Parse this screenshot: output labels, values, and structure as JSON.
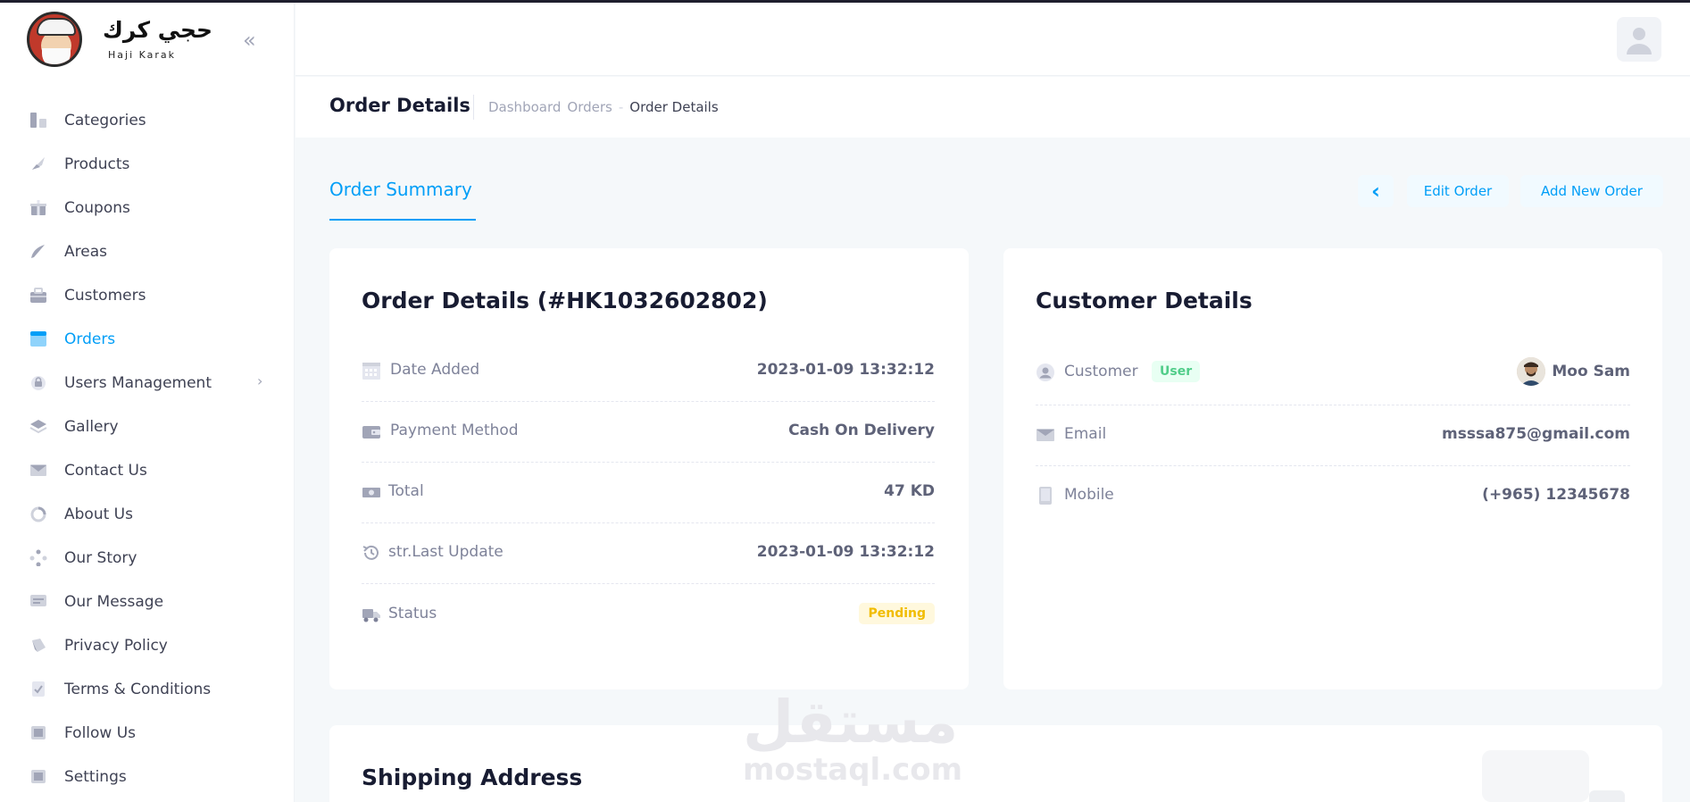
{
  "brand": {
    "name_ar": "حجي كرك",
    "name_en": "Haji Karak"
  },
  "sidebar": {
    "items": [
      {
        "label": "Categories",
        "icon": "categories-icon"
      },
      {
        "label": "Products",
        "icon": "rocket-icon"
      },
      {
        "label": "Coupons",
        "icon": "gift-icon"
      },
      {
        "label": "Areas",
        "icon": "pen-icon"
      },
      {
        "label": "Customers",
        "icon": "briefcase-icon"
      },
      {
        "label": "Orders",
        "icon": "window-icon",
        "active": true
      },
      {
        "label": "Users Management",
        "icon": "lock-icon",
        "has_submenu": true
      },
      {
        "label": "Gallery",
        "icon": "layers-icon"
      },
      {
        "label": "Contact Us",
        "icon": "mail-icon"
      },
      {
        "label": "About Us",
        "icon": "pie-chart-icon"
      },
      {
        "label": "Our Story",
        "icon": "diamond-dots-icon"
      },
      {
        "label": "Our Message",
        "icon": "message-icon"
      },
      {
        "label": "Privacy Policy",
        "icon": "shield-icon"
      },
      {
        "label": "Terms & Conditions",
        "icon": "check-doc-icon"
      },
      {
        "label": "Follow Us",
        "icon": "share-icon"
      },
      {
        "label": "Settings",
        "icon": "settings-icon"
      }
    ],
    "submenu_arrow": "›",
    "collapse_glyph": "«"
  },
  "page": {
    "title": "Order Details",
    "breadcrumb": {
      "dashboard": "Dashboard",
      "orders": "Orders",
      "separator": "-",
      "current": "Order Details"
    }
  },
  "toolbar": {
    "tab_label": "Order Summary",
    "back_glyph": "‹",
    "edit_label": "Edit Order",
    "add_label": "Add New Order"
  },
  "order_card": {
    "title": "Order Details (#HK1032602802)",
    "rows": {
      "date_added": {
        "label": "Date Added",
        "value": "2023-01-09 13:32:12"
      },
      "payment": {
        "label": "Payment Method",
        "value": "Cash On Delivery"
      },
      "total": {
        "label": "Total",
        "value": "47 KD"
      },
      "last_update": {
        "label": "str.Last Update",
        "value": "2023-01-09 13:32:12"
      },
      "status": {
        "label": "Status",
        "value": "Pending"
      }
    }
  },
  "customer_card": {
    "title": "Customer Details",
    "rows": {
      "customer": {
        "label": "Customer",
        "badge": "User",
        "value": "Moo Sam"
      },
      "email": {
        "label": "Email",
        "value": "msssa875@gmail.com"
      },
      "mobile": {
        "label": "Mobile",
        "value": "(+965) 12345678"
      }
    }
  },
  "shipping_card": {
    "title": "Shipping Address"
  },
  "watermark": {
    "ar": "مستقل",
    "en": "mostaql.com"
  },
  "colors": {
    "primary": "#009ef7",
    "pending_bg": "#fff8dd",
    "pending_text": "#f1bc00",
    "user_badge_bg": "#e8fff3",
    "user_badge_text": "#50cd89",
    "page_bg": "#f5f8fa"
  }
}
